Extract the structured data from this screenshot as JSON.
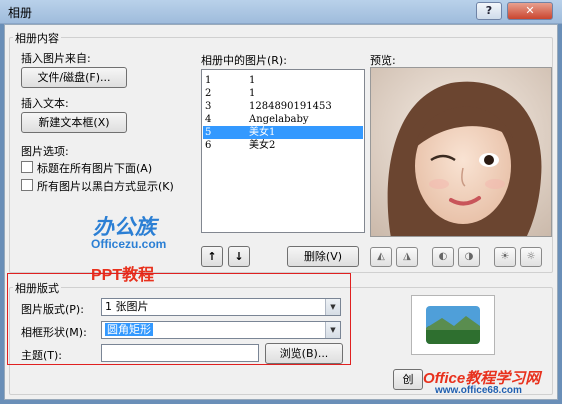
{
  "window": {
    "title": "相册",
    "help_label": "?",
    "close_label": "✕"
  },
  "content_group": {
    "label": "相册内容",
    "insert_from_label": "插入图片来自:",
    "file_button": "文件/磁盘(F)...",
    "insert_text_label": "插入文本:",
    "new_textbox_button": "新建文本框(X)",
    "picture_options_label": "图片选项:",
    "caption_below": "标题在所有图片下面(A)",
    "all_black_white": "所有图片以黑白方式显示(K)"
  },
  "pictures": {
    "label": "相册中的图片(R):",
    "items": [
      {
        "num": "1",
        "name": "1"
      },
      {
        "num": "2",
        "name": "1"
      },
      {
        "num": "3",
        "name": "1284890191453"
      },
      {
        "num": "4",
        "name": "Angelababy"
      },
      {
        "num": "5",
        "name": "美女1"
      },
      {
        "num": "6",
        "name": "美女2"
      }
    ],
    "selected_index": 4,
    "up_label": "↑",
    "down_label": "↓",
    "delete_button": "删除(V)"
  },
  "preview": {
    "label": "预览:"
  },
  "layout_group": {
    "label": "相册版式",
    "picture_layout_label": "图片版式(P):",
    "picture_layout_value": "1 张图片",
    "frame_shape_label": "相框形状(M):",
    "frame_shape_value": "圆角矩形",
    "theme_label": "主题(T):",
    "theme_value": "",
    "browse_button": "浏览(B)..."
  },
  "watermarks": {
    "brand_cn": "办公族",
    "brand_url": "Officezu.com",
    "ppt_tutorial": "PPT教程",
    "corner_text": "Office教程学习网",
    "corner_url": "www.office68.com"
  },
  "partial_button": "创"
}
